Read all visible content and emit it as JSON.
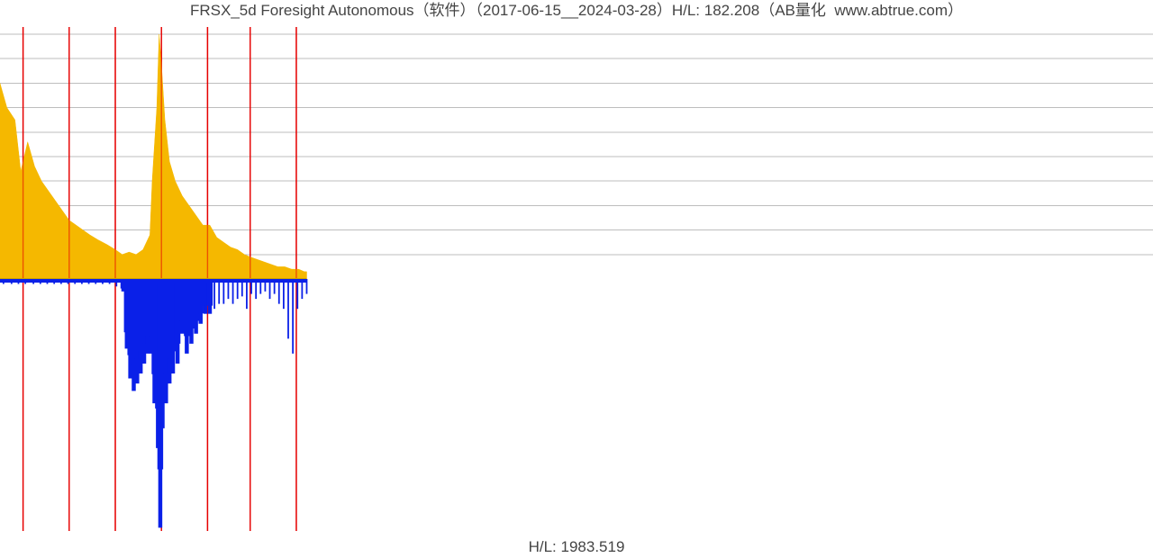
{
  "title": "FRSX_5d Foresight Autonomous（软件）（2017-06-15__2024-03-28）H/L: 182.208（AB量化  www.abtrue.com）",
  "subtitle": "H/L: 1983.519",
  "chart_data": {
    "type": "area",
    "title": "FRSX_5d Foresight Autonomous（软件）（2017-06-15__2024-03-28）H/L: 182.208（AB量化  www.abtrue.com）",
    "xlabel": "",
    "ylabel": "",
    "x_range_label": [
      "2017-06-15",
      "2024-03-28"
    ],
    "y_baseline": 0,
    "upper_ylim": [
      0,
      100
    ],
    "lower_ylim": [
      -100,
      0
    ],
    "n_grid_h_upper": 10,
    "vline_x_pct": [
      2.0,
      6.0,
      10.0,
      14.0,
      18.0,
      21.7,
      25.7
    ],
    "data_extent_pct": 26.6,
    "series": [
      {
        "name": "upper",
        "color": "#f5b800",
        "kind": "filled-area-above-baseline",
        "x_pct": [
          0.0,
          0.6,
          1.3,
          1.8,
          2.4,
          3.0,
          3.6,
          4.2,
          4.8,
          5.4,
          6.0,
          6.6,
          7.2,
          7.8,
          8.5,
          9.3,
          10.0,
          10.6,
          11.2,
          11.8,
          12.4,
          13.0,
          13.2,
          13.6,
          13.8,
          14.0,
          14.3,
          14.7,
          15.2,
          15.8,
          16.4,
          17.0,
          17.6,
          18.2,
          18.8,
          19.4,
          20.0,
          20.6,
          21.2,
          21.7,
          22.3,
          22.9,
          23.5,
          24.1,
          24.7,
          25.3,
          25.9,
          26.4,
          26.6
        ],
        "y_rel": [
          80,
          70,
          65,
          44,
          56,
          46,
          40,
          36,
          32,
          28,
          24,
          22,
          20,
          18,
          16,
          14,
          12,
          10,
          11,
          10,
          12,
          18,
          40,
          70,
          100,
          88,
          65,
          48,
          40,
          34,
          30,
          26,
          22,
          22,
          17,
          15,
          13,
          12,
          10,
          9,
          8,
          7,
          6,
          5,
          5,
          4,
          4,
          3,
          3
        ]
      },
      {
        "name": "lower",
        "color": "#0a20e8",
        "kind": "spikes-below-baseline",
        "x_pct": [
          0.3,
          1.0,
          1.6,
          2.2,
          2.9,
          3.5,
          4.1,
          4.7,
          5.3,
          5.9,
          6.5,
          7.1,
          7.7,
          8.3,
          8.9,
          9.5,
          10.1,
          10.7,
          11.0,
          11.3,
          11.6,
          11.9,
          12.2,
          12.5,
          12.8,
          13.1,
          13.4,
          13.7,
          13.9,
          14.1,
          14.4,
          14.7,
          15.0,
          15.4,
          15.8,
          16.2,
          16.6,
          17.0,
          17.4,
          17.8,
          18.2,
          18.6,
          19.0,
          19.4,
          19.8,
          20.2,
          20.6,
          21.0,
          21.4,
          21.8,
          22.2,
          22.6,
          23.0,
          23.4,
          23.8,
          24.2,
          24.6,
          25.0,
          25.4,
          25.8,
          26.2,
          26.6
        ],
        "y_rel": [
          2,
          2,
          2,
          2,
          2,
          2,
          2,
          2,
          2,
          2,
          2,
          2,
          2,
          2,
          2,
          2,
          3,
          5,
          28,
          40,
          45,
          42,
          38,
          34,
          30,
          30,
          50,
          68,
          100,
          60,
          50,
          42,
          38,
          34,
          22,
          30,
          26,
          22,
          18,
          14,
          14,
          12,
          10,
          10,
          8,
          10,
          8,
          7,
          12,
          6,
          8,
          6,
          5,
          8,
          6,
          10,
          12,
          24,
          30,
          12,
          8,
          6
        ]
      }
    ]
  }
}
